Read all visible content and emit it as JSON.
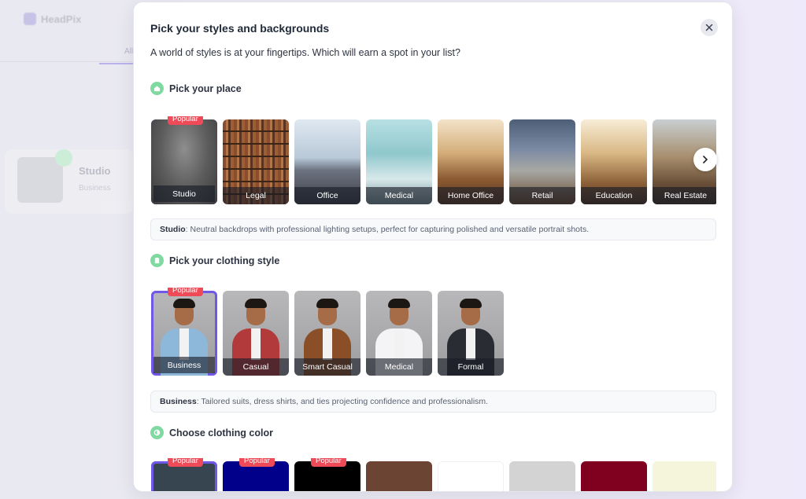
{
  "background": {
    "logo_text": "HeadPix",
    "tab_text": "All",
    "card_title": "Studio",
    "card_sub": "Business"
  },
  "modal": {
    "title": "Pick your styles and backgrounds",
    "subtitle": "A world of styles is at your fingertips. Which will earn a spot in your list?",
    "close_icon": "close-icon"
  },
  "places": {
    "heading": "Pick your place",
    "icon": "home-icon",
    "popular_label": "Popular",
    "items": [
      {
        "label": "Studio",
        "selected": true,
        "popular": true
      },
      {
        "label": "Legal"
      },
      {
        "label": "Office"
      },
      {
        "label": "Medical"
      },
      {
        "label": "Home Office"
      },
      {
        "label": "Retail"
      },
      {
        "label": "Education"
      },
      {
        "label": "Real Estate"
      }
    ],
    "description_name": "Studio",
    "description_text": ": Neutral backdrops with professional lighting setups, perfect for capturing polished and versatile portrait shots."
  },
  "clothing": {
    "heading": "Pick your clothing style",
    "icon": "shirt-icon",
    "popular_label": "Popular",
    "items": [
      {
        "label": "Business",
        "selected": true,
        "popular": true,
        "color": "#8eb8d9"
      },
      {
        "label": "Casual",
        "color": "#b33a3a"
      },
      {
        "label": "Smart Casual",
        "color": "#8a4f27"
      },
      {
        "label": "Medical",
        "color": "#f4f4f6"
      },
      {
        "label": "Formal",
        "color": "#2a2c33"
      }
    ],
    "description_name": "Business",
    "description_text": ": Tailored suits, dress shirts, and ties projecting confidence and professionalism."
  },
  "colors": {
    "heading": "Choose clothing color",
    "icon": "palette-icon",
    "popular_label": "Popular",
    "swatches": [
      {
        "color": "#36454f",
        "selected": true,
        "popular": true
      },
      {
        "color": "#00008b",
        "popular": true
      },
      {
        "color": "#000000",
        "popular": true
      },
      {
        "color": "#6b4433"
      },
      {
        "color": "#ffffff"
      },
      {
        "color": "#d3d3d3"
      },
      {
        "color": "#800020"
      },
      {
        "color": "#f5f5dc"
      }
    ]
  },
  "accent_color": "#7157e5",
  "popular_color": "#ef4a57"
}
